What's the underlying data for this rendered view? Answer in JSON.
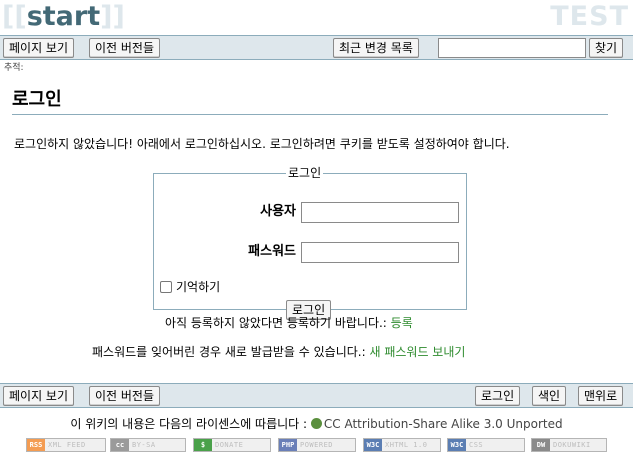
{
  "header": {
    "site_bracket_open": "[[",
    "site_title": "start",
    "site_bracket_close": "]]",
    "wiki_name": "TEST"
  },
  "toolbar_top": {
    "show_page": "페이지 보기",
    "old_revisions": "이전 버전들",
    "recent_changes": "최근 변경 목록",
    "search_value": "",
    "search_button": "찾기"
  },
  "breadcrumbs": {
    "label": "추적:"
  },
  "page": {
    "title": "로그인",
    "intro": "로그인하지 않았습니다! 아래에서 로그인하십시오. 로그인하려면 쿠키를 받도록 설정하여야 합니다."
  },
  "login_form": {
    "legend": "로그인",
    "user_label": "사용자",
    "user_value": "",
    "password_label": "패스워드",
    "password_value": "",
    "remember_label": "기억하기",
    "remember_checked": false,
    "submit": "로그인"
  },
  "register_note": {
    "text": "아직 등록하지 않았다면 등록하기 바랍니다.:",
    "link": "등록"
  },
  "reset_note": {
    "text": "패스워드를 잊어버린 경우 새로 발급받을 수 있습니다.:",
    "link": "새 패스워드 보내기"
  },
  "toolbar_bottom": {
    "show_page": "페이지 보기",
    "old_revisions": "이전 버전들",
    "login": "로그인",
    "index": "색인",
    "top": "맨위로"
  },
  "license": {
    "text": "이 위키의 내용은 다음의 라이센스에 따릅니다 :",
    "link": "CC Attribution-Share Alike 3.0 Unported"
  },
  "badges": [
    {
      "mark": "RSS",
      "text": "XML FEED",
      "color": "#f49c52"
    },
    {
      "mark": "cc",
      "text": "BY-SA",
      "color": "#9a9a9a"
    },
    {
      "mark": "$",
      "text": "DONATE",
      "color": "#4aa14a"
    },
    {
      "mark": "PHP",
      "text": "POWERED",
      "color": "#6a7fb8"
    },
    {
      "mark": "W3C",
      "text": "XHTML 1.0",
      "color": "#5b7eb3"
    },
    {
      "mark": "W3C",
      "text": "CSS",
      "color": "#5b7eb3"
    },
    {
      "mark": "DW",
      "text": "DOKUWIKI",
      "color": "#8a8a8a"
    }
  ],
  "colors": {
    "bar_background": "#dee7ec",
    "bar_border": "#8cacbb",
    "title_blue": "#436976",
    "link_green": "#2e8b2e"
  }
}
